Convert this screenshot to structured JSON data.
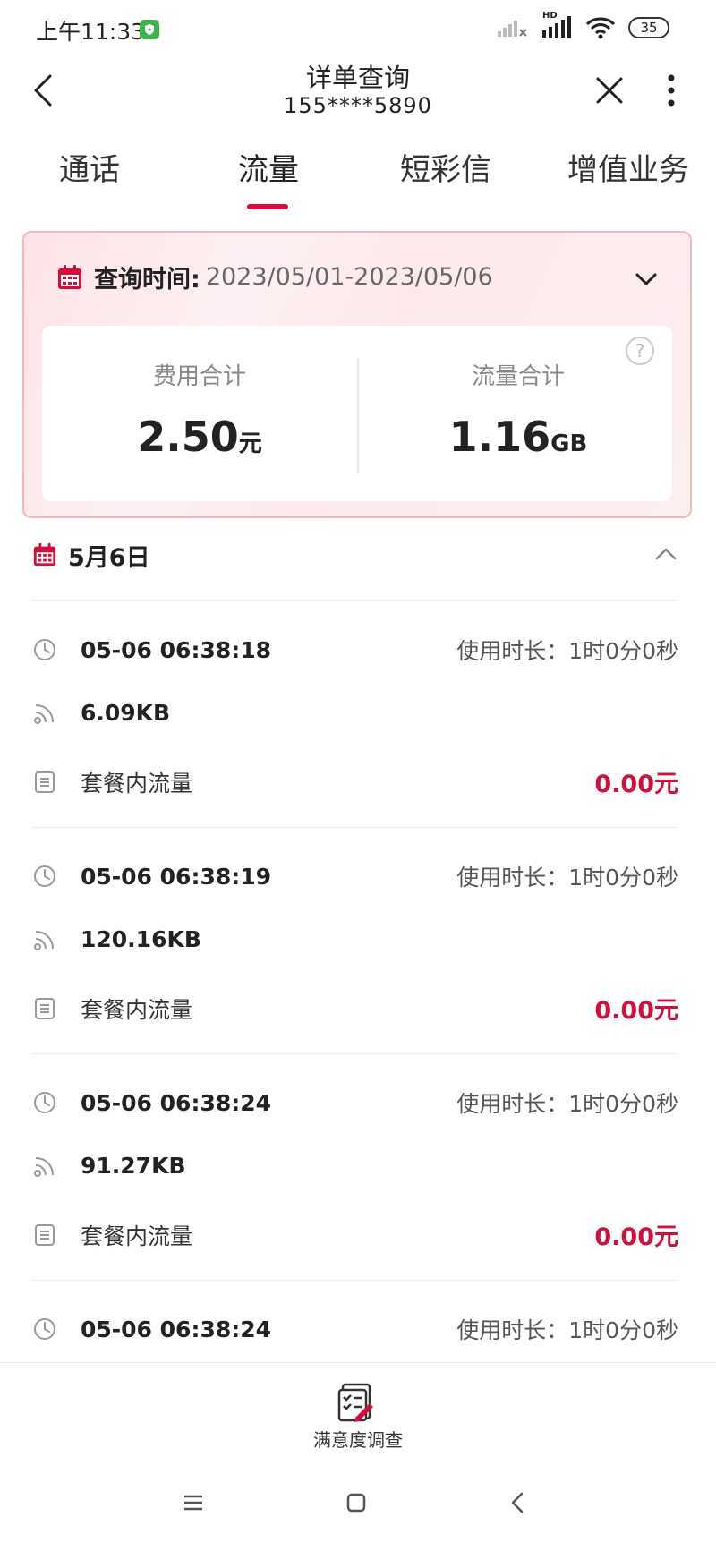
{
  "status_bar": {
    "time": "上午11:33",
    "battery": "35",
    "network_label": "HD"
  },
  "header": {
    "title": "详单查询",
    "phone": "155****5890"
  },
  "tabs": [
    {
      "label": "通话"
    },
    {
      "label": "流量",
      "active": true
    },
    {
      "label": "短彩信"
    },
    {
      "label": "增值业务"
    }
  ],
  "summary": {
    "query_label": "查询时间:",
    "query_range": "2023/05/01-2023/05/06",
    "fee_label": "费用合计",
    "fee_value": "2.50",
    "fee_unit": "元",
    "data_label": "流量合计",
    "data_value": "1.16",
    "data_unit": "GB"
  },
  "day": {
    "label": "5月6日"
  },
  "records": [
    {
      "time": "05-06 06:38:18",
      "duration_label": "使用时长：",
      "duration": "1时0分0秒",
      "amount": "6.09KB",
      "type": "套餐内流量",
      "fee": "0.00元"
    },
    {
      "time": "05-06 06:38:19",
      "duration_label": "使用时长：",
      "duration": "1时0分0秒",
      "amount": "120.16KB",
      "type": "套餐内流量",
      "fee": "0.00元"
    },
    {
      "time": "05-06 06:38:24",
      "duration_label": "使用时长：",
      "duration": "1时0分0秒",
      "amount": "91.27KB",
      "type": "套餐内流量",
      "fee": "0.00元"
    },
    {
      "time": "05-06 06:38:24",
      "duration_label": "使用时长：",
      "duration": "1时0分0秒"
    }
  ],
  "bottom": {
    "survey_label": "满意度调查"
  },
  "colors": {
    "accent": "#d0103a",
    "card_border": "#f5b8c1",
    "card_bg": "#fde9ec"
  }
}
